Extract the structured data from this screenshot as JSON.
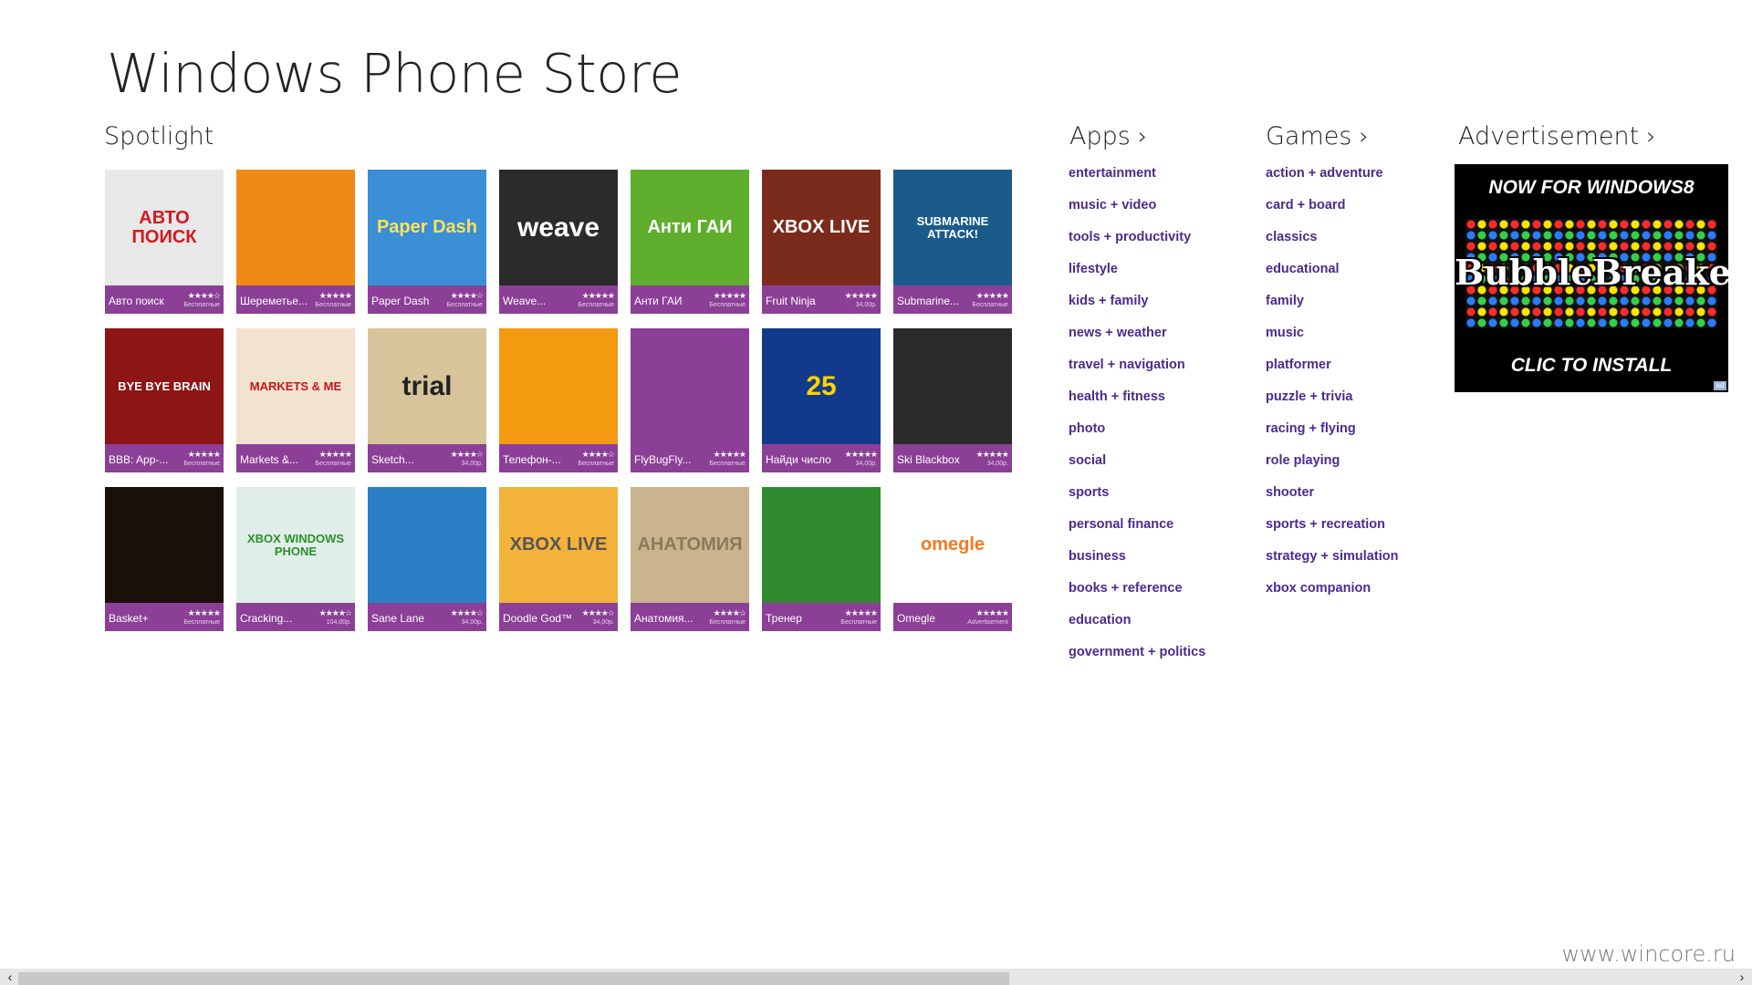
{
  "app": {
    "title": "Windows Phone Store"
  },
  "sections": {
    "spotlight": "Spotlight",
    "apps": "Apps",
    "games": "Games",
    "advertisement": "Advertisement",
    "chevron": "›"
  },
  "tiles": [
    {
      "name": "Авто поиск",
      "stars": "★★★★☆",
      "price": "Бесплатные",
      "art_text": "АВТО ПОИСК",
      "art_color": "#e8e8e8",
      "text_color": "#d5191f",
      "icon": "car-icon"
    },
    {
      "name": "Шереметье...",
      "stars": "★★★★★",
      "price": "Бесплатные",
      "art_text": "",
      "art_color": "#f08a14",
      "text_color": "#ffffff",
      "icon": "airline-logo-icon"
    },
    {
      "name": "Paper Dash",
      "stars": "★★★★☆",
      "price": "Бесплатные",
      "art_text": "Paper Dash",
      "art_color": "#3a8fd6",
      "text_color": "#ffe25a",
      "icon": "paper-dash-icon"
    },
    {
      "name": "Weave...",
      "stars": "★★★★★",
      "price": "Бесплатные",
      "art_text": "weave",
      "art_color": "#2b2b2b",
      "text_color": "#ffffff",
      "icon": "weave-icon"
    },
    {
      "name": "Анти ГАИ",
      "stars": "★★★★★",
      "price": "Бесплатные",
      "art_text": "Анти ГАИ",
      "art_color": "#5fae2e",
      "text_color": "#ffffff",
      "icon": "prohibition-icon"
    },
    {
      "name": "Fruit Ninja",
      "stars": "★★★★★",
      "price": "34,00р.",
      "art_text": "XBOX LIVE",
      "art_color": "#7a2b1c",
      "text_color": "#ffffff",
      "icon": "watermelon-icon"
    },
    {
      "name": "Submarine...",
      "stars": "★★★★★",
      "price": "Бесплатные",
      "art_text": "SUBMARINE ATTACK!",
      "art_color": "#1a5b8c",
      "text_color": "#ffffff",
      "icon": "submarine-icon"
    },
    {
      "name": "BBB: App-...",
      "stars": "★★★★★",
      "price": "Бесплатные",
      "art_text": "BYE BYE BRAIN",
      "art_color": "#8d1515",
      "text_color": "#ffffff",
      "icon": "chainsaw-icon"
    },
    {
      "name": "Markets &...",
      "stars": "★★★★★",
      "price": "Бесплатные",
      "art_text": "MARKETS & ME",
      "art_color": "#f2e3cf",
      "text_color": "#c4161c",
      "icon": "newspaper-icon"
    },
    {
      "name": "Sketch...",
      "stars": "★★★★☆",
      "price": "34,00р.",
      "art_text": "trial",
      "art_color": "#d7c49a",
      "text_color": "#222222",
      "icon": "camera-icon"
    },
    {
      "name": "Телефон-...",
      "stars": "★★★★☆",
      "price": "Бесплатные",
      "art_text": "",
      "art_color": "#f39a10",
      "text_color": "#ffffff",
      "icon": "phone-icon"
    },
    {
      "name": "FlyBugFly...",
      "stars": "★★★★★",
      "price": "Бесплатные",
      "art_text": "",
      "art_color": "#8c3f97",
      "text_color": "#ffffff",
      "icon": "ladybug-icon"
    },
    {
      "name": "Найди число",
      "stars": "★★★★★",
      "price": "34,00р.",
      "art_text": "25",
      "art_color": "#123a8c",
      "text_color": "#ffd200",
      "icon": "numbers-icon"
    },
    {
      "name": "Ski Blackbox",
      "stars": "★★★★★",
      "price": "34,00р.",
      "art_text": "",
      "art_color": "#2a2a2a",
      "text_color": "#ffffff",
      "icon": "ski-track-icon"
    },
    {
      "name": "Basket+",
      "stars": "★★★★★",
      "price": "Бесплатные",
      "art_text": "",
      "art_color": "#1a0f0a",
      "text_color": "#ff7a1a",
      "icon": "flaming-basketball-icon"
    },
    {
      "name": "Cracking...",
      "stars": "★★★★☆",
      "price": "104,00р.",
      "art_text": "XBOX WINDOWS PHONE",
      "art_color": "#dfeee8",
      "text_color": "#2b8f2b",
      "icon": "buggy-icon"
    },
    {
      "name": "Sane Lane",
      "stars": "★★★★☆",
      "price": "34,00р.",
      "art_text": "",
      "art_color": "#2b7fc4",
      "text_color": "#ffffff",
      "icon": "race-car-icon"
    },
    {
      "name": "Doodle God™",
      "stars": "★★★★☆",
      "price": "34,00р.",
      "art_text": "XBOX LIVE",
      "art_color": "#f3b23a",
      "text_color": "#555555",
      "icon": "eye-icon"
    },
    {
      "name": "Анатомия...",
      "stars": "★★★★☆",
      "price": "Бесплатные",
      "art_text": "АНАТОМИЯ",
      "art_color": "#c9b48e",
      "text_color": "#8a7a5a",
      "icon": "skull-icon"
    },
    {
      "name": "Тренер",
      "stars": "★★★★★",
      "price": "Бесплатные",
      "art_text": "",
      "art_color": "#2f8a2f",
      "text_color": "#ffffff",
      "icon": "bodybuilder-icon"
    },
    {
      "name": "Omegle",
      "stars": "★★★★★",
      "price": "Advertisement",
      "art_text": "omegle",
      "art_color": "#ffffff",
      "text_color": "#f47a20",
      "icon": "omegle-logo-icon"
    }
  ],
  "apps_categories": [
    "entertainment",
    "music + video",
    "tools + productivity",
    "lifestyle",
    "kids + family",
    "news + weather",
    "travel + navigation",
    "health + fitness",
    "photo",
    "social",
    "sports",
    "personal finance",
    "business",
    "books + reference",
    "education",
    "government + politics"
  ],
  "games_categories": [
    "action + adventure",
    "card + board",
    "classics",
    "educational",
    "family",
    "music",
    "platformer",
    "puzzle + trivia",
    "racing + flying",
    "role playing",
    "shooter",
    "sports + recreation",
    "strategy + simulation",
    "xbox companion"
  ],
  "ad": {
    "top": "NOW FOR WINDOWS8",
    "logo": "BubbleBreaker",
    "bottom": "CLIC TO INSTALL",
    "corner": "ad"
  },
  "scrollbar": {
    "left_arrow": "‹",
    "right_arrow": "›"
  },
  "watermark": "www.wincore.ru"
}
